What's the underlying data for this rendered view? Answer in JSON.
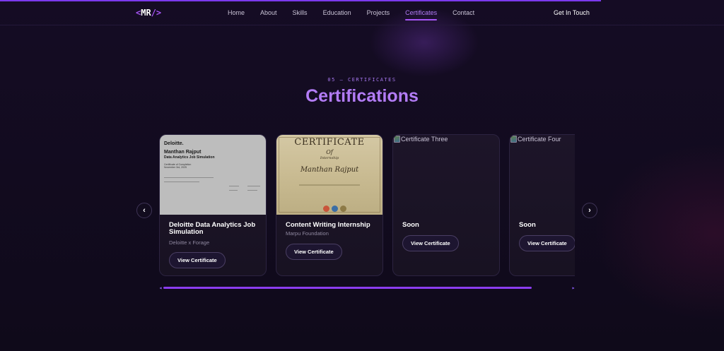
{
  "nav": {
    "logo": {
      "open": "<",
      "text": "MR",
      "close": "/>"
    },
    "links": [
      {
        "label": "Home"
      },
      {
        "label": "About"
      },
      {
        "label": "Skills"
      },
      {
        "label": "Education"
      },
      {
        "label": "Projects"
      },
      {
        "label": "Certificates",
        "active": true
      },
      {
        "label": "Contact"
      }
    ],
    "cta_label": "Get In Touch"
  },
  "section": {
    "label": "05 — CERTIFICATES",
    "title": "Certifications"
  },
  "cards": [
    {
      "image": {
        "brand": "Deloitte.",
        "name": "Manthan Rajput",
        "program": "Data Analytics Job Simulation",
        "line1": "Certificate of Completion",
        "line2": "November 3rd, 2025"
      },
      "title": "Deloitte Data Analytics Job Simulation",
      "subtitle": "Deloitte x Forage",
      "button": "View Certificate"
    },
    {
      "image": {
        "heading": "CERTIFICATE",
        "of": "Of",
        "sub": "Internship",
        "name": "Manthan Rajput"
      },
      "title": "Content Writing Internship",
      "subtitle": "Marpu Foundation",
      "button": "View Certificate"
    },
    {
      "image_alt": "Certificate Three",
      "title": "Soon",
      "button": "View Certificate"
    },
    {
      "image_alt": "Certificate Four",
      "title": "Soon",
      "button": "View Certificate"
    }
  ],
  "carousel": {
    "prev_symbol": "‹",
    "next_symbol": "›",
    "scroll_position": 0.89
  },
  "colors": {
    "accent": "#a855f7",
    "background": "#0f0a1a",
    "card_border": "#2c2340"
  }
}
